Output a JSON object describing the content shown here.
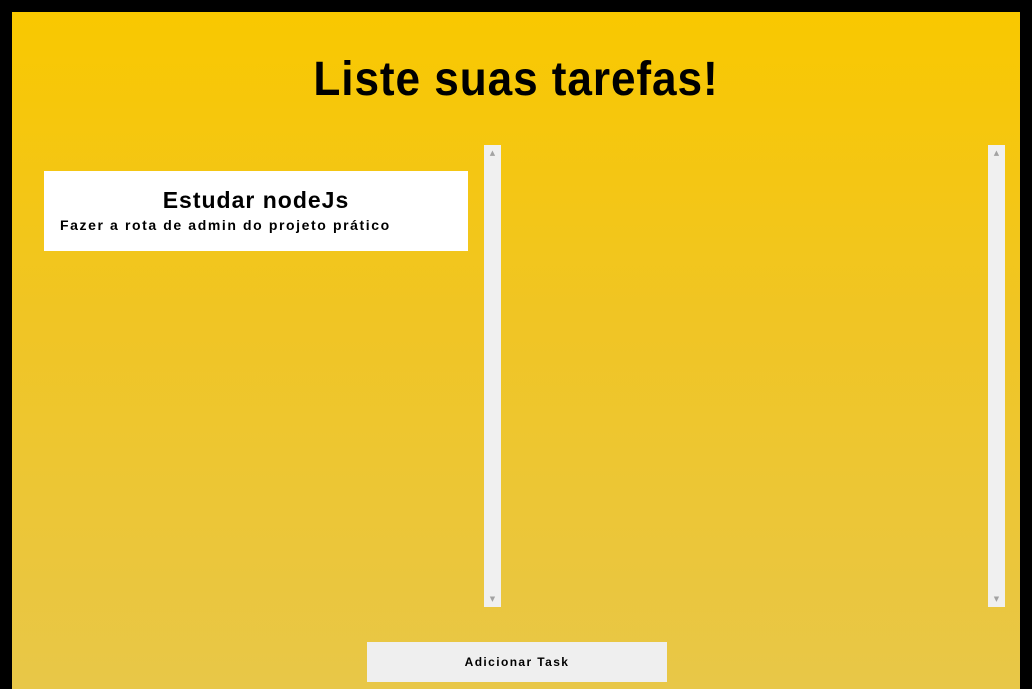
{
  "page": {
    "title": "Liste suas tarefas!"
  },
  "tasks": [
    {
      "title": "Estudar nodeJs",
      "description": "Fazer a rota de admin do projeto prático"
    }
  ],
  "actions": {
    "add_task_label": "Adicionar Task"
  },
  "icons": {
    "scroll_up": "scroll-up-arrow-icon",
    "scroll_down": "scroll-down-arrow-icon"
  },
  "colors": {
    "background_top": "#f9c800",
    "background_bottom": "#e8c748",
    "card_background": "#ffffff",
    "button_background": "#efefef",
    "scrollbar_track": "#f0f0f0",
    "text": "#000000"
  }
}
